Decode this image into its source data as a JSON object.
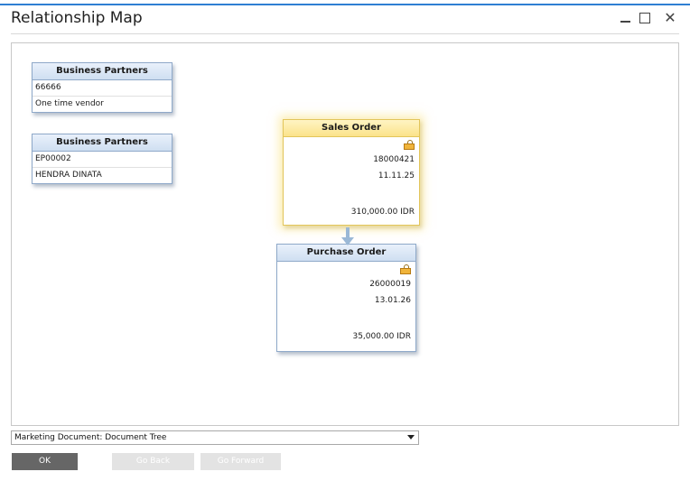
{
  "window": {
    "title": "Relationship Map",
    "controls": {
      "minimize": "_",
      "maximize": "□",
      "close": "✕"
    }
  },
  "map": {
    "nodes": [
      {
        "header": "Business Partners",
        "rows": [
          "66666",
          "One time vendor"
        ]
      },
      {
        "header": "Business Partners",
        "rows": [
          "EP00002",
          "HENDRA DINATA"
        ]
      }
    ],
    "sales_order": {
      "header": "Sales Order",
      "number": "18000421",
      "date": "11.11.25",
      "amount": "310,000.00 IDR",
      "lock_icon": "lock-open-icon"
    },
    "purchase_order": {
      "header": "Purchase Order",
      "number": "26000019",
      "date": "13.01.26",
      "amount": "35,000.00 IDR",
      "lock_icon": "lock-open-icon"
    }
  },
  "footer": {
    "view_select": "Marketing Document: Document Tree",
    "ok_label": "OK",
    "back_label": "Go Back",
    "forward_label": "Go Forward"
  },
  "colors": {
    "accent": "#2f7fd3",
    "selected_header": "#fbe38a",
    "node_header": "#cfdff1",
    "ok_button": "#666666"
  }
}
